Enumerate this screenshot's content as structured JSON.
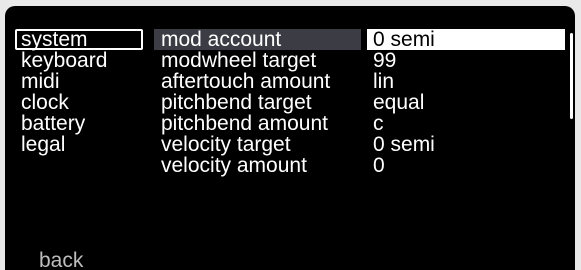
{
  "menu": [
    {
      "label": "system",
      "selected": true
    },
    {
      "label": "keyboard"
    },
    {
      "label": "midi"
    },
    {
      "label": "clock"
    },
    {
      "label": "battery"
    },
    {
      "label": "legal"
    }
  ],
  "settings": [
    {
      "label": "mod account",
      "value": "0 semi"
    },
    {
      "label": "modwheel target",
      "value": "99"
    },
    {
      "label": "aftertouch amount",
      "value": "lin"
    },
    {
      "label": "pitchbend target",
      "value": "equal"
    },
    {
      "label": "pitchbend amount",
      "value": "c"
    },
    {
      "label": "velocity target",
      "value": "0 semi"
    },
    {
      "label": "velocity amount",
      "value": "0"
    }
  ],
  "footer": {
    "back_label": "back"
  },
  "colors": {
    "background": "#000000",
    "text": "#ffffff",
    "highlight": "#3c3c44",
    "selected_value_bg": "#ffffff"
  }
}
